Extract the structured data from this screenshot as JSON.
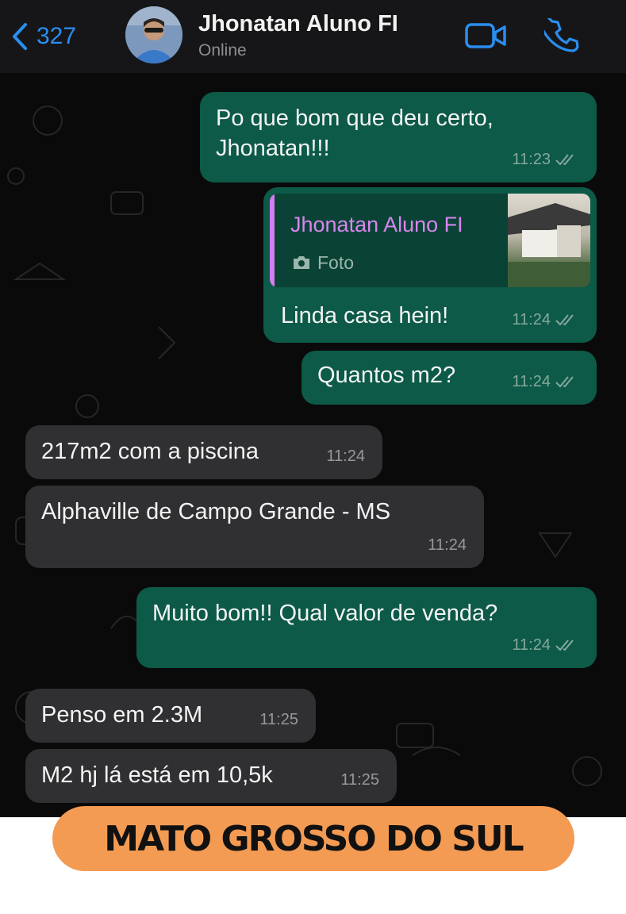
{
  "header": {
    "back_count": "327",
    "contact_name": "Jhonatan Aluno FI",
    "status": "Online"
  },
  "colors": {
    "accent": "#2a8ef0",
    "outgoing_bubble": "#0c5a47",
    "incoming_bubble": "#303032",
    "quote_name": "#d885ef",
    "banner": "#f39a53"
  },
  "messages": [
    {
      "direction": "out",
      "text": "Po que bom que deu certo,\nJhonatan!!!",
      "time": "11:23",
      "read": true
    },
    {
      "direction": "out",
      "quote": {
        "name": "Jhonatan Aluno FI",
        "type": "Foto"
      },
      "text": "Linda casa hein!",
      "time": "11:24",
      "read": true
    },
    {
      "direction": "out",
      "text": "Quantos m2?",
      "time": "11:24",
      "read": true
    },
    {
      "direction": "in",
      "text": "217m2 com a piscina",
      "time": "11:24"
    },
    {
      "direction": "in",
      "text": "Alphaville de Campo Grande - MS",
      "time": "11:24"
    },
    {
      "direction": "out",
      "text": "Muito bom!! Qual valor de venda?",
      "time": "11:24",
      "read": true
    },
    {
      "direction": "in",
      "text": "Penso em 2.3M",
      "time": "11:25"
    },
    {
      "direction": "in",
      "text": "M2 hj lá está em 10,5k",
      "time": "11:25"
    }
  ],
  "banner": {
    "label": "MATO GROSSO DO SUL"
  }
}
